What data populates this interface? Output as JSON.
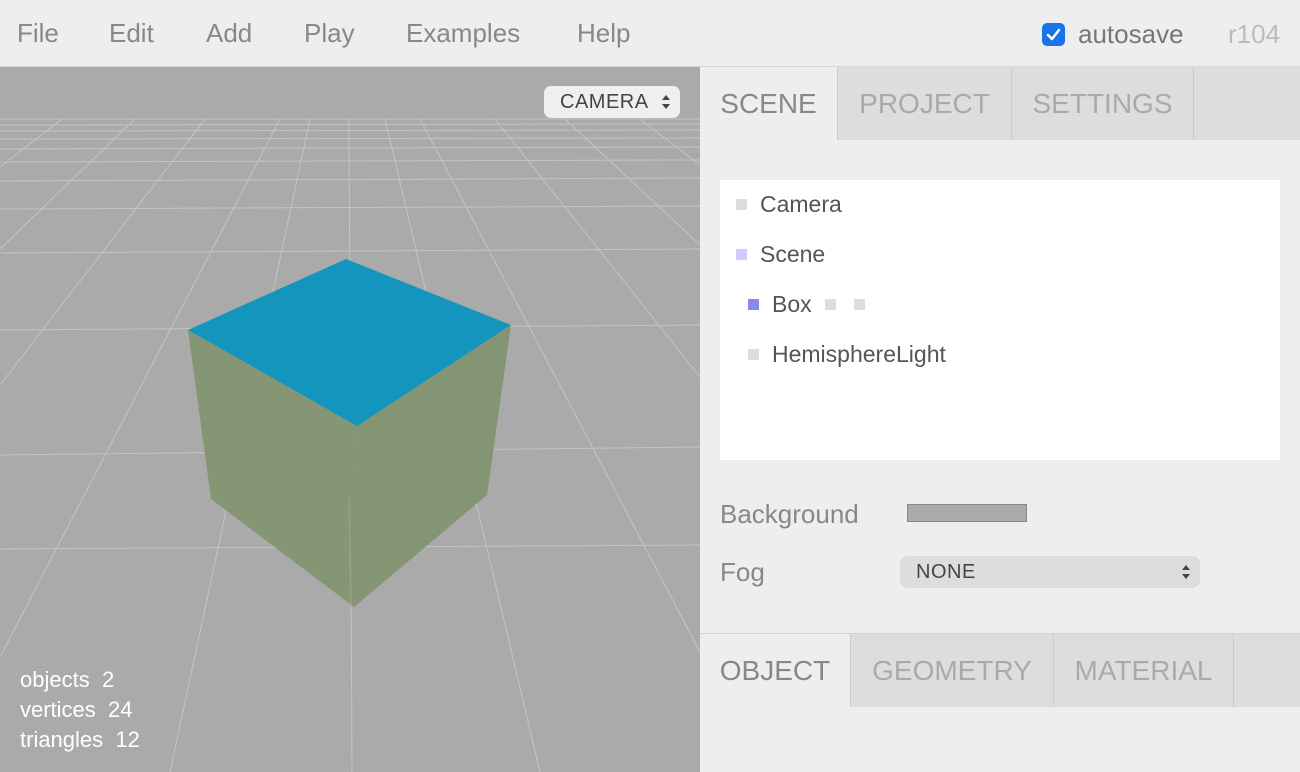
{
  "menubar": {
    "items": [
      "File",
      "Edit",
      "Add",
      "Play",
      "Examples",
      "Help"
    ],
    "autosave_label": "autosave",
    "autosave_checked": true,
    "version": "r104"
  },
  "viewport": {
    "camera_select": "CAMERA",
    "stats": {
      "objects_label": "objects",
      "objects": "2",
      "vertices_label": "vertices",
      "vertices": "24",
      "triangles_label": "triangles",
      "triangles": "12"
    },
    "colors": {
      "background": "#aaaaaa",
      "box_top": "#1495bd",
      "box_sides": "#859675"
    }
  },
  "sidebar": {
    "top_tabs": [
      "SCENE",
      "PROJECT",
      "SETTINGS"
    ],
    "active_top_tab": "SCENE",
    "outliner": [
      {
        "label": "Camera",
        "type": "camera",
        "color": "#dddddd"
      },
      {
        "label": "Scene",
        "type": "scene",
        "color": "#ccccff"
      },
      {
        "label": "Box",
        "type": "mesh",
        "color": "#8888ee"
      },
      {
        "label": "HemisphereLight",
        "type": "light",
        "color": "#dddddd"
      }
    ],
    "background_label": "Background",
    "background_color": "#aaaaaa",
    "fog_label": "Fog",
    "fog_value": "NONE",
    "bottom_tabs": [
      "OBJECT",
      "GEOMETRY",
      "MATERIAL"
    ],
    "active_bottom_tab": "OBJECT"
  }
}
